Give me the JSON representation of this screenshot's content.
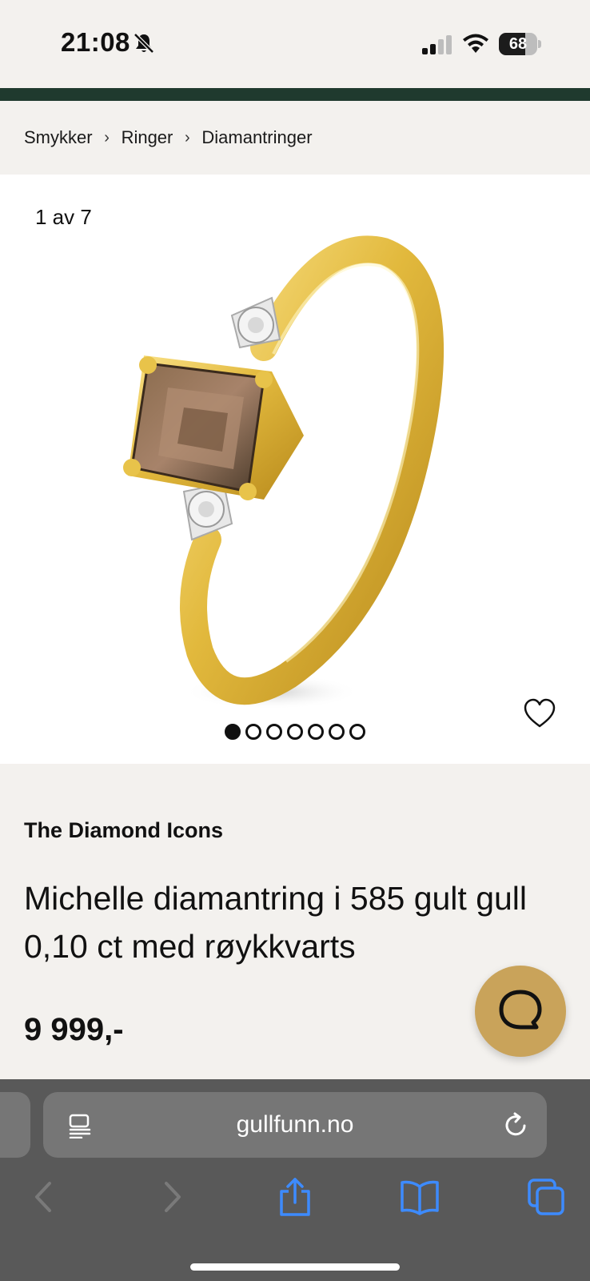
{
  "status_bar": {
    "time": "21:08",
    "battery_level": "68",
    "icons": [
      "bell-slash-icon",
      "cellular-signal-icon",
      "wifi-icon",
      "battery-icon"
    ]
  },
  "breadcrumb": {
    "items": [
      {
        "label": "Smykker"
      },
      {
        "label": "Ringer"
      },
      {
        "label": "Diamantringer"
      }
    ],
    "separator": "›"
  },
  "gallery": {
    "counter": "1 av 7",
    "image_count": 7,
    "active_index": 0,
    "favorite_icon": "heart-outline-icon"
  },
  "product": {
    "brand": "The Diamond Icons",
    "title": "Michelle diamantring i 585 gult gull 0,10 ct med røykkvarts",
    "price": "9 999,-"
  },
  "chat": {
    "icon": "chat-bubble-icon",
    "color": "#c9a35a"
  },
  "browser": {
    "url": "gullfunn.no",
    "toolbar_icons": [
      "back-icon",
      "forward-icon",
      "share-icon",
      "bookmarks-icon",
      "tabs-icon"
    ],
    "accent_color": "#3d8bff"
  },
  "colors": {
    "brand_strip": "#1f3a2e",
    "page_background": "#f3f1ee"
  }
}
